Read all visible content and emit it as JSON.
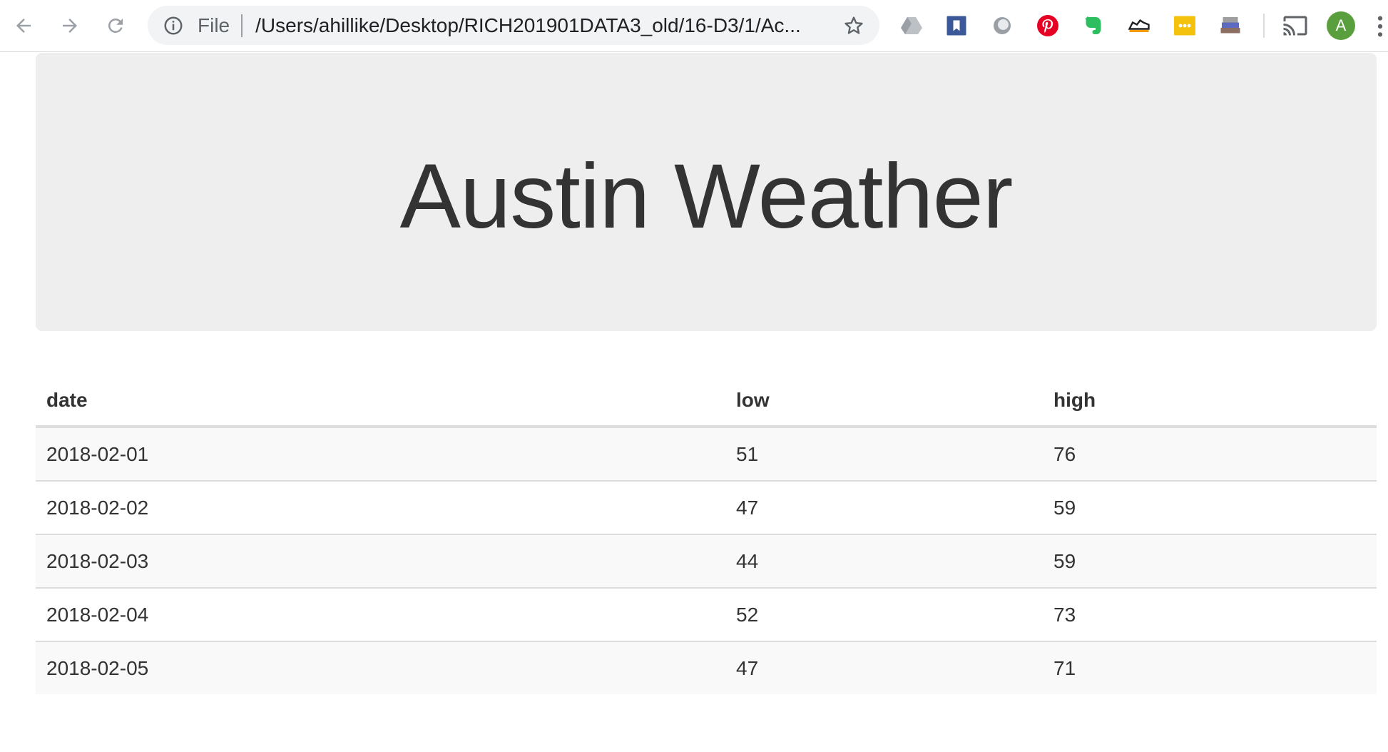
{
  "browser": {
    "url_scheme": "File",
    "url": "/Users/ahillike/Desktop/RICH201901DATA3_old/16-D3/1/Ac...",
    "profile_initial": "A",
    "extensions": [
      "drive-icon",
      "bookmark-icon",
      "circle-extension-icon",
      "pinterest-icon",
      "evernote-icon",
      "sneaker-icon",
      "dots-extension-icon",
      "books-icon"
    ],
    "colors": {
      "pinterest": "#e60023",
      "evernote": "#2dbe60",
      "bookmark": "#3b5998",
      "dots_ext": "#f4c20d",
      "avatar": "#5a9f3e"
    }
  },
  "page": {
    "title": "Austin Weather",
    "table": {
      "headers": [
        "date",
        "low",
        "high"
      ],
      "rows": [
        [
          "2018-02-01",
          "51",
          "76"
        ],
        [
          "2018-02-02",
          "47",
          "59"
        ],
        [
          "2018-02-03",
          "44",
          "59"
        ],
        [
          "2018-02-04",
          "52",
          "73"
        ],
        [
          "2018-02-05",
          "47",
          "71"
        ]
      ]
    }
  }
}
